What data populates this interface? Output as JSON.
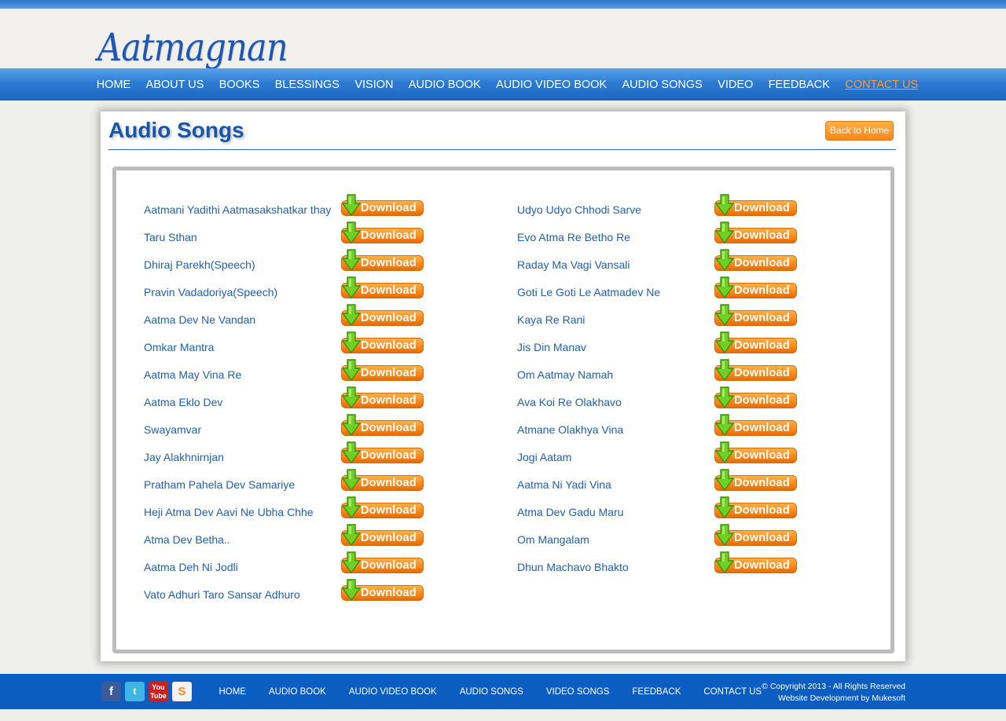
{
  "site": {
    "logo_text": "Aatmagnan"
  },
  "nav": {
    "items": [
      "HOME",
      "ABOUT US",
      "BOOKS",
      "BLESSINGS",
      "VISION",
      "AUDIO BOOK",
      "AUDIO VIDEO BOOK",
      "AUDIO SONGS",
      "VIDEO",
      "FEEDBACK",
      "CONTACT US"
    ],
    "active": "CONTACT US"
  },
  "page": {
    "title": "Audio Songs",
    "back_label": "Back to Home",
    "download_label": "Download"
  },
  "songs_left": [
    "Aatmani Yadithi Aatmasakshatkar thay",
    "Taru Sthan",
    "Dhiraj Parekh(Speech)",
    "Pravin Vadadoriya(Speech)",
    "Aatma Dev Ne Vandan",
    "Omkar Mantra",
    "Aatma May Vina Re",
    "Aatma Eklo Dev",
    "Swayamvar",
    "Jay Alakhnirnjan",
    "Pratham Pahela Dev Samariye",
    "Heji Atma Dev Aavi Ne Ubha Chhe",
    "Atma Dev Betha..",
    "Aatma Deh Ni Jodli",
    "Vato Adhuri Taro Sansar Adhuro"
  ],
  "songs_right": [
    "Udyo Udyo Chhodi Sarve",
    "Evo Atma Re Betho Re",
    "Raday Ma Vagi Vansali",
    "Goti Le Goti Le Aatmadev Ne",
    "Kaya Re Rani",
    "Jis Din Manav",
    "Om Aatmay Namah",
    "Ava Koi Re Olakhavo",
    "Atmane Olakhya Vina",
    "Jogi Aatam",
    "Aatma Ni Yadi Vina",
    "Atma Dev Gadu Maru",
    "Om Mangalam",
    "Dhun Machavo Bhakto"
  ],
  "footer": {
    "social_icons": [
      "facebook-icon",
      "twitter-icon",
      "youtube-icon",
      "stumbleupon-icon"
    ],
    "nav": [
      "HOME",
      "AUDIO BOOK",
      "AUDIO VIDEO BOOK",
      "AUDIO SONGS",
      "VIDEO SONGS",
      "FEEDBACK",
      "CONTACT US"
    ],
    "copyright": "© Copyright 2013 - All Rights Reserved",
    "credit": "Website Development by Mukesoft"
  },
  "colors": {
    "accent_blue": "#1d57b3",
    "nav_blue": "#2c7bd2",
    "download_orange": "#f98a1b",
    "link_blue": "#1e5fae",
    "footer_blue": "#0b5dc1"
  }
}
